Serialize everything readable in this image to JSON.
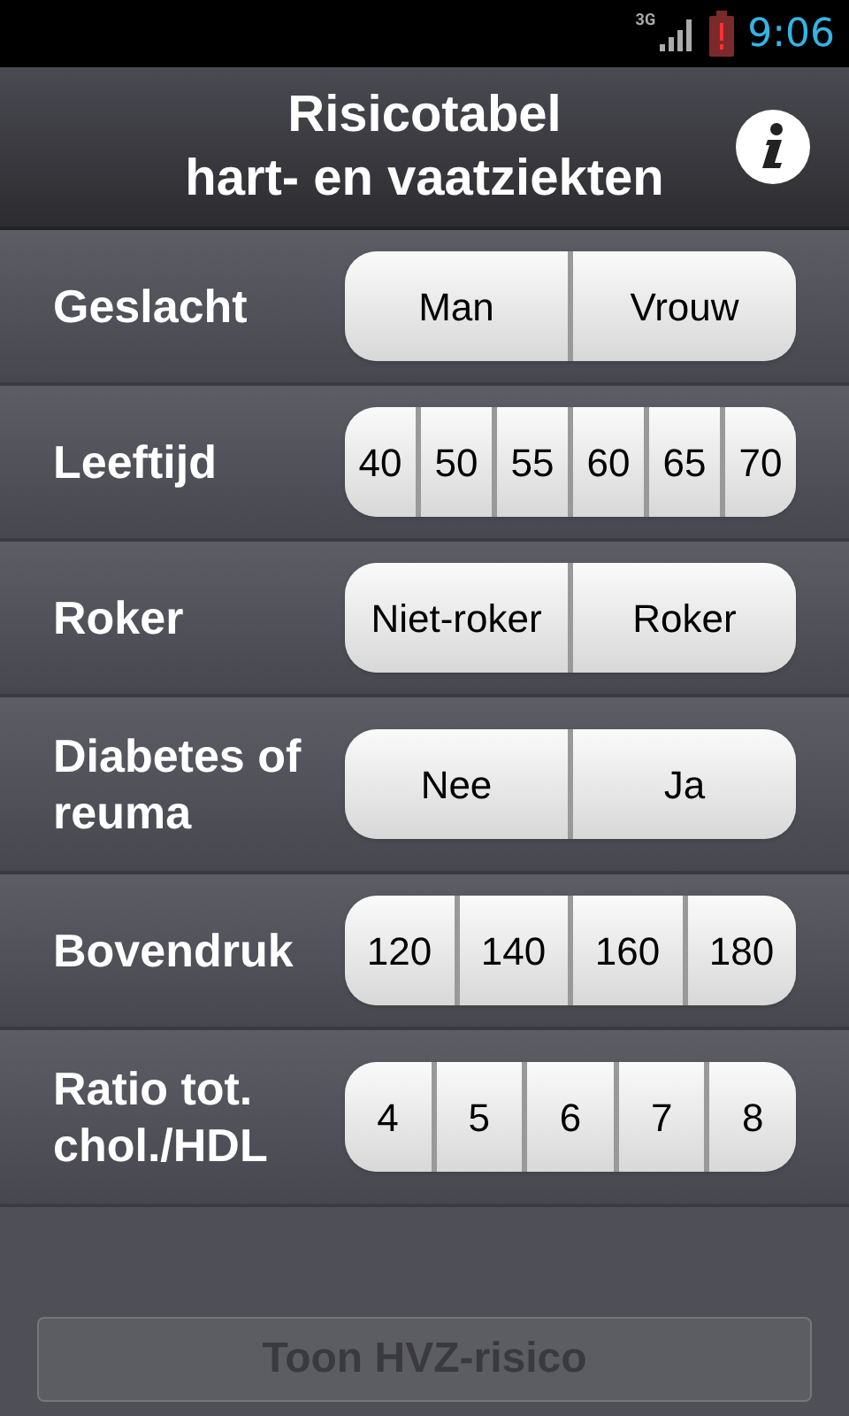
{
  "status_bar": {
    "network": "3G",
    "time": "9:06"
  },
  "header": {
    "title_line_1": "Risicotabel",
    "title_line_2": "hart- en vaatziekten"
  },
  "rows": [
    {
      "label": "Geslacht",
      "options": [
        {
          "label": "Man",
          "selected": false
        },
        {
          "label": "Vrouw",
          "selected": false
        }
      ]
    },
    {
      "label": "Leeftijd",
      "options": [
        {
          "label": "40",
          "selected": false
        },
        {
          "label": "50",
          "selected": false
        },
        {
          "label": "55",
          "selected": false
        },
        {
          "label": "60",
          "selected": false
        },
        {
          "label": "65",
          "selected": false
        },
        {
          "label": "70",
          "selected": false
        }
      ]
    },
    {
      "label": "Roker",
      "options": [
        {
          "label": "Niet-roker",
          "selected": false
        },
        {
          "label": "Roker",
          "selected": false
        }
      ]
    },
    {
      "label": "Diabetes of reuma",
      "options": [
        {
          "label": "Nee",
          "selected": false
        },
        {
          "label": "Ja",
          "selected": false
        }
      ]
    },
    {
      "label": "Bovendruk",
      "options": [
        {
          "label": "120",
          "selected": false
        },
        {
          "label": "140",
          "selected": false
        },
        {
          "label": "160",
          "selected": false
        },
        {
          "label": "180",
          "selected": false
        }
      ]
    },
    {
      "label": "Ratio tot. chol./HDL",
      "options": [
        {
          "label": "4",
          "selected": false
        },
        {
          "label": "5",
          "selected": false
        },
        {
          "label": "6",
          "selected": false
        },
        {
          "label": "7",
          "selected": false
        },
        {
          "label": "8",
          "selected": false
        }
      ]
    }
  ],
  "action_button": {
    "label": "Toon HVZ-risico",
    "disabled": true
  }
}
